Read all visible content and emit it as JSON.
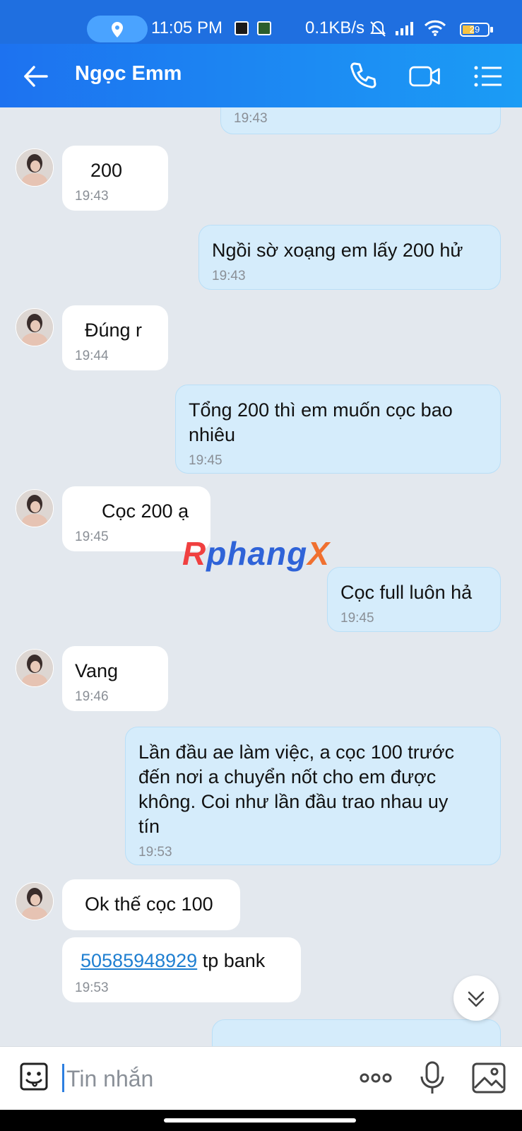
{
  "status_bar": {
    "time": "11:05 PM",
    "network_speed": "0.1KB/s",
    "battery": "29",
    "icons": [
      "location-icon",
      "mute-icon",
      "signal-icon",
      "wifi-icon",
      "battery-icon"
    ]
  },
  "header": {
    "title": "Ngọc Emm",
    "icons": [
      "back-arrow-icon",
      "phone-icon",
      "video-camera-icon",
      "menu-list-icon"
    ]
  },
  "messages": [
    {
      "side": "out",
      "text": "",
      "time": "19:43"
    },
    {
      "side": "in",
      "text": "200",
      "time": "19:43"
    },
    {
      "side": "out",
      "text": "Ngồi sờ xoạng em lấy 200 hử",
      "time": "19:43"
    },
    {
      "side": "in",
      "text": "Đúng r",
      "time": "19:44"
    },
    {
      "side": "out",
      "text": "Tổng 200 thì em muốn cọc bao nhiêu",
      "line1": "Tổng 200 thì em muốn cọc bao",
      "line2": "nhiêu",
      "time": "19:45"
    },
    {
      "side": "in",
      "text": "Cọc 200 ạ",
      "time": "19:45"
    },
    {
      "side": "out",
      "text": "Cọc full luôn hả",
      "time": "19:45"
    },
    {
      "side": "in",
      "text": "Vang",
      "time": "19:46"
    },
    {
      "side": "out",
      "line1": "Lần đầu ae làm việc, a cọc 100 trước",
      "line2": "đến nơi a chuyển nốt cho em được",
      "line3": "không. Coi như lần đầu trao nhau uy",
      "line4": "tín",
      "time": "19:53"
    },
    {
      "side": "in",
      "text": "Ok thế cọc 100"
    },
    {
      "side": "in",
      "link": "50585948929",
      "text": " tp bank",
      "time": "19:53"
    }
  ],
  "watermark": {
    "a": "R",
    "b": "phang",
    "c": "X"
  },
  "input": {
    "placeholder": "Tin nhắn"
  },
  "colors": {
    "header": "#1d72f0",
    "outgoing_bubble": "#d5ecfb",
    "incoming_bubble": "#ffffff",
    "background": "#e3e8ee",
    "link": "#1f7fd1"
  }
}
